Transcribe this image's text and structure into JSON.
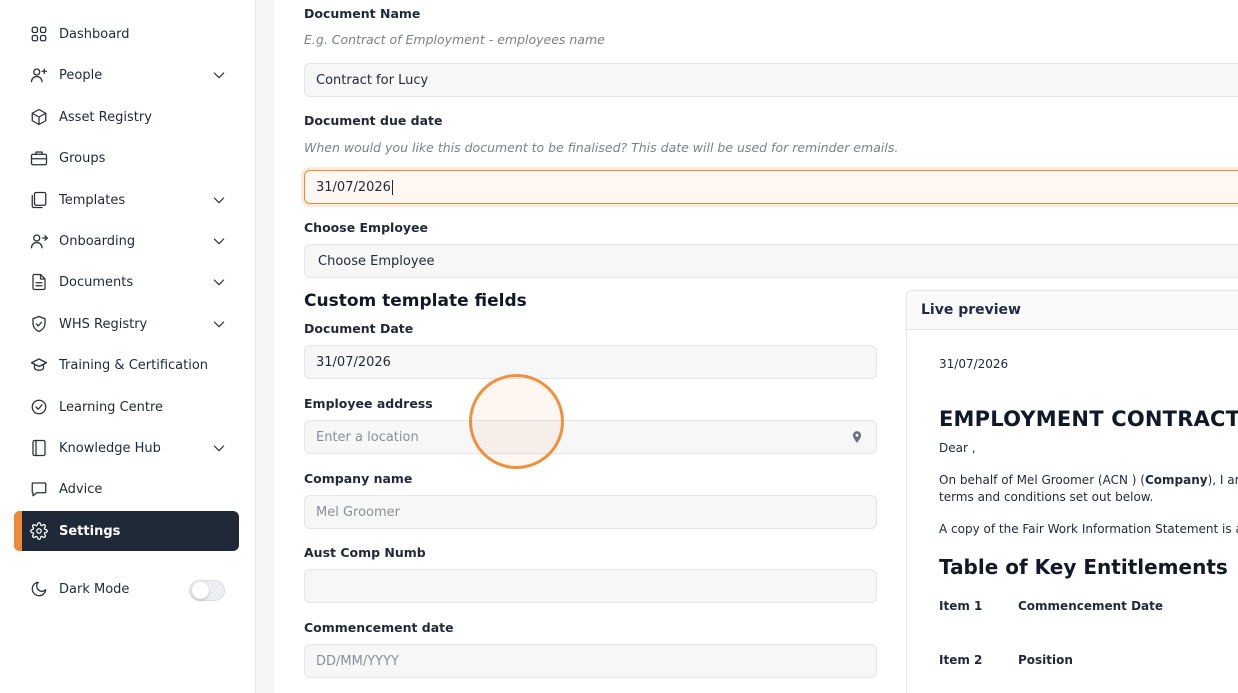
{
  "sidebar": {
    "items": [
      {
        "label": "Dashboard",
        "icon": "grid-icon"
      },
      {
        "label": "People",
        "icon": "user-plus-icon"
      },
      {
        "label": "Asset Registry",
        "icon": "cube-icon"
      },
      {
        "label": "Groups",
        "icon": "briefcase-icon"
      },
      {
        "label": "Templates",
        "icon": "copy-icon"
      },
      {
        "label": "Onboarding",
        "icon": "user-arrow-icon"
      },
      {
        "label": "Documents",
        "icon": "file-icon"
      },
      {
        "label": "WHS Registry",
        "icon": "shield-check-icon"
      },
      {
        "label": "Training & Certification",
        "icon": "graduation-cap-icon"
      },
      {
        "label": "Learning Centre",
        "icon": "check-circle-icon"
      },
      {
        "label": "Knowledge Hub",
        "icon": "book-icon"
      },
      {
        "label": "Advice",
        "icon": "chat-bubble-icon"
      },
      {
        "label": "Settings",
        "icon": "gear-icon"
      }
    ],
    "dark_mode_label": "Dark Mode",
    "dark_mode_enabled": false,
    "accent_color": "#f0883a",
    "active_bg": "#1f2937"
  },
  "form": {
    "document_name": {
      "label": "Document Name",
      "hint": "E.g. Contract of Employment - employees name",
      "value": "Contract for Lucy"
    },
    "due_date": {
      "label": "Document due date",
      "hint": "When would you like this document to be finalised? This date will be used for reminder emails.",
      "value": "31/07/2026"
    },
    "employee": {
      "label": "Choose Employee",
      "value": "Choose Employee"
    },
    "custom_title": "Custom template fields",
    "document_date": {
      "label": "Document Date",
      "value": "31/07/2026"
    },
    "employee_address": {
      "label": "Employee address",
      "placeholder": "Enter a location"
    },
    "company_name": {
      "label": "Company name",
      "value": "Mel Groomer"
    },
    "aust_comp_numb": {
      "label": "Aust Comp Numb",
      "value": ""
    },
    "commencement_date": {
      "label": "Commencement date",
      "placeholder": "DD/MM/YYYY"
    }
  },
  "preview": {
    "title": "Live preview",
    "date": "31/07/2026",
    "heading": "EMPLOYMENT CONTRACT",
    "dear": "Dear ,",
    "line1_a": "On behalf of Mel Groomer (ACN ) (",
    "line1_bold": "Company",
    "line1_b": "), I am pleas",
    "line2": "terms and conditions set out below.",
    "line3": "A copy of the Fair Work Information Statement is attach",
    "table_heading": "Table of Key Entitlements",
    "rows": [
      {
        "item": "Item 1",
        "name": "Commencement Date"
      },
      {
        "item": "Item 2",
        "name": "Position"
      }
    ]
  }
}
